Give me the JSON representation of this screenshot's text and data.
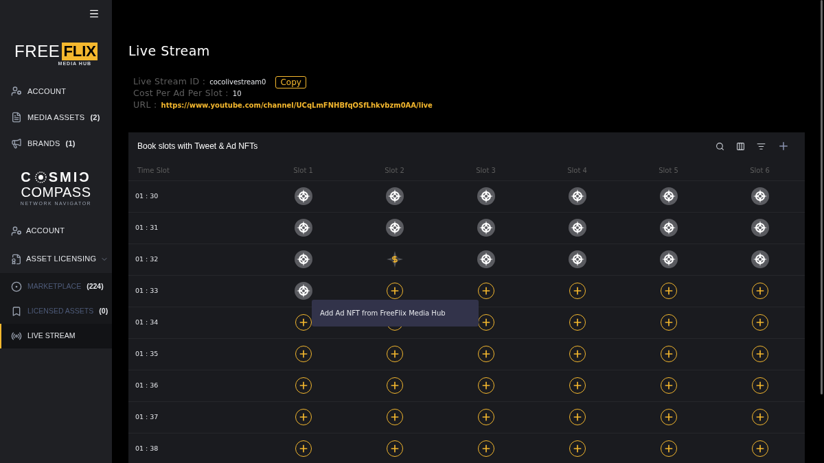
{
  "brand_top": {
    "word_1": "FREE",
    "word_2": "FLIX",
    "tagline": "MEDIA HUB"
  },
  "menu_top": [
    {
      "label": "ACCOUNT"
    },
    {
      "label": "MEDIA ASSETS",
      "count": "(2)"
    },
    {
      "label": "BRANDS",
      "count": "(1)"
    }
  ],
  "brand_bottom": {
    "line_1_start": "C",
    "line_1_end": "SMIƆ",
    "line_2": "COMPASS",
    "tagline": "NETWORK NAVIGATOR"
  },
  "menu_bottom": [
    {
      "label": "ACCOUNT"
    },
    {
      "label": "ASSET LICENSING",
      "expanded": true,
      "children": [
        {
          "label": "MARKETPLACE",
          "count": "(224)",
          "dimmed": true,
          "selected": false
        },
        {
          "label": "LICENSED ASSETS",
          "count": "(0)",
          "dimmed": true,
          "selected": false
        },
        {
          "label": "LIVE STREAM",
          "dimmed": false,
          "selected": true
        }
      ]
    }
  ],
  "page_title": "Live Stream",
  "info": [
    {
      "label": "Live Stream ID :",
      "value": "cocolivestream0",
      "kind": "id",
      "button": "Copy"
    },
    {
      "label": "Cost Per Ad Per Slot :",
      "value": "10",
      "kind": "plain"
    },
    {
      "label": "URL :",
      "value": "https://www.youtube.com/channel/UCqLmFNHBfqOSfLhkvbzm0AA/live",
      "kind": "link"
    }
  ],
  "table": {
    "title": "Book slots with Tweet & Ad NFTs",
    "columns": [
      "Time Slot",
      "Slot 1",
      "Slot 2",
      "Slot 3",
      "Slot 4",
      "Slot 5",
      "Slot 6"
    ],
    "rows": [
      {
        "time": "01 : 30",
        "slots": [
          {
            "kind": "booked"
          },
          {
            "kind": "booked"
          },
          {
            "kind": "booked"
          },
          {
            "kind": "booked"
          },
          {
            "kind": "booked"
          },
          {
            "kind": "booked"
          }
        ]
      },
      {
        "time": "01 : 31",
        "slots": [
          {
            "kind": "booked"
          },
          {
            "kind": "booked"
          },
          {
            "kind": "booked"
          },
          {
            "kind": "booked"
          },
          {
            "kind": "booked"
          },
          {
            "kind": "booked"
          }
        ]
      },
      {
        "time": "01 : 32",
        "slots": [
          {
            "kind": "booked"
          },
          {
            "kind": "nft"
          },
          {
            "kind": "booked"
          },
          {
            "kind": "booked"
          },
          {
            "kind": "booked"
          },
          {
            "kind": "booked"
          }
        ]
      },
      {
        "time": "01 : 33",
        "slots": [
          {
            "kind": "booked"
          },
          {
            "kind": "add"
          },
          {
            "kind": "add"
          },
          {
            "kind": "add"
          },
          {
            "kind": "add"
          },
          {
            "kind": "add"
          }
        ]
      },
      {
        "time": "01 : 34",
        "slots": [
          {
            "kind": "add"
          },
          {
            "kind": "add"
          },
          {
            "kind": "add"
          },
          {
            "kind": "add"
          },
          {
            "kind": "add"
          },
          {
            "kind": "add"
          }
        ]
      },
      {
        "time": "01 : 35",
        "slots": [
          {
            "kind": "add"
          },
          {
            "kind": "add"
          },
          {
            "kind": "add"
          },
          {
            "kind": "add"
          },
          {
            "kind": "add"
          },
          {
            "kind": "add"
          }
        ]
      },
      {
        "time": "01 : 36",
        "slots": [
          {
            "kind": "add"
          },
          {
            "kind": "add"
          },
          {
            "kind": "add"
          },
          {
            "kind": "add"
          },
          {
            "kind": "add"
          },
          {
            "kind": "add"
          }
        ]
      },
      {
        "time": "01 : 37",
        "slots": [
          {
            "kind": "add"
          },
          {
            "kind": "add"
          },
          {
            "kind": "add"
          },
          {
            "kind": "add"
          },
          {
            "kind": "add"
          },
          {
            "kind": "add"
          }
        ]
      },
      {
        "time": "01 : 38",
        "slots": [
          {
            "kind": "add"
          },
          {
            "kind": "add"
          },
          {
            "kind": "add"
          },
          {
            "kind": "add"
          },
          {
            "kind": "add"
          },
          {
            "kind": "add"
          }
        ]
      }
    ]
  },
  "tooltip": {
    "text": "Add Ad NFT from FreeFlix Media Hub"
  }
}
